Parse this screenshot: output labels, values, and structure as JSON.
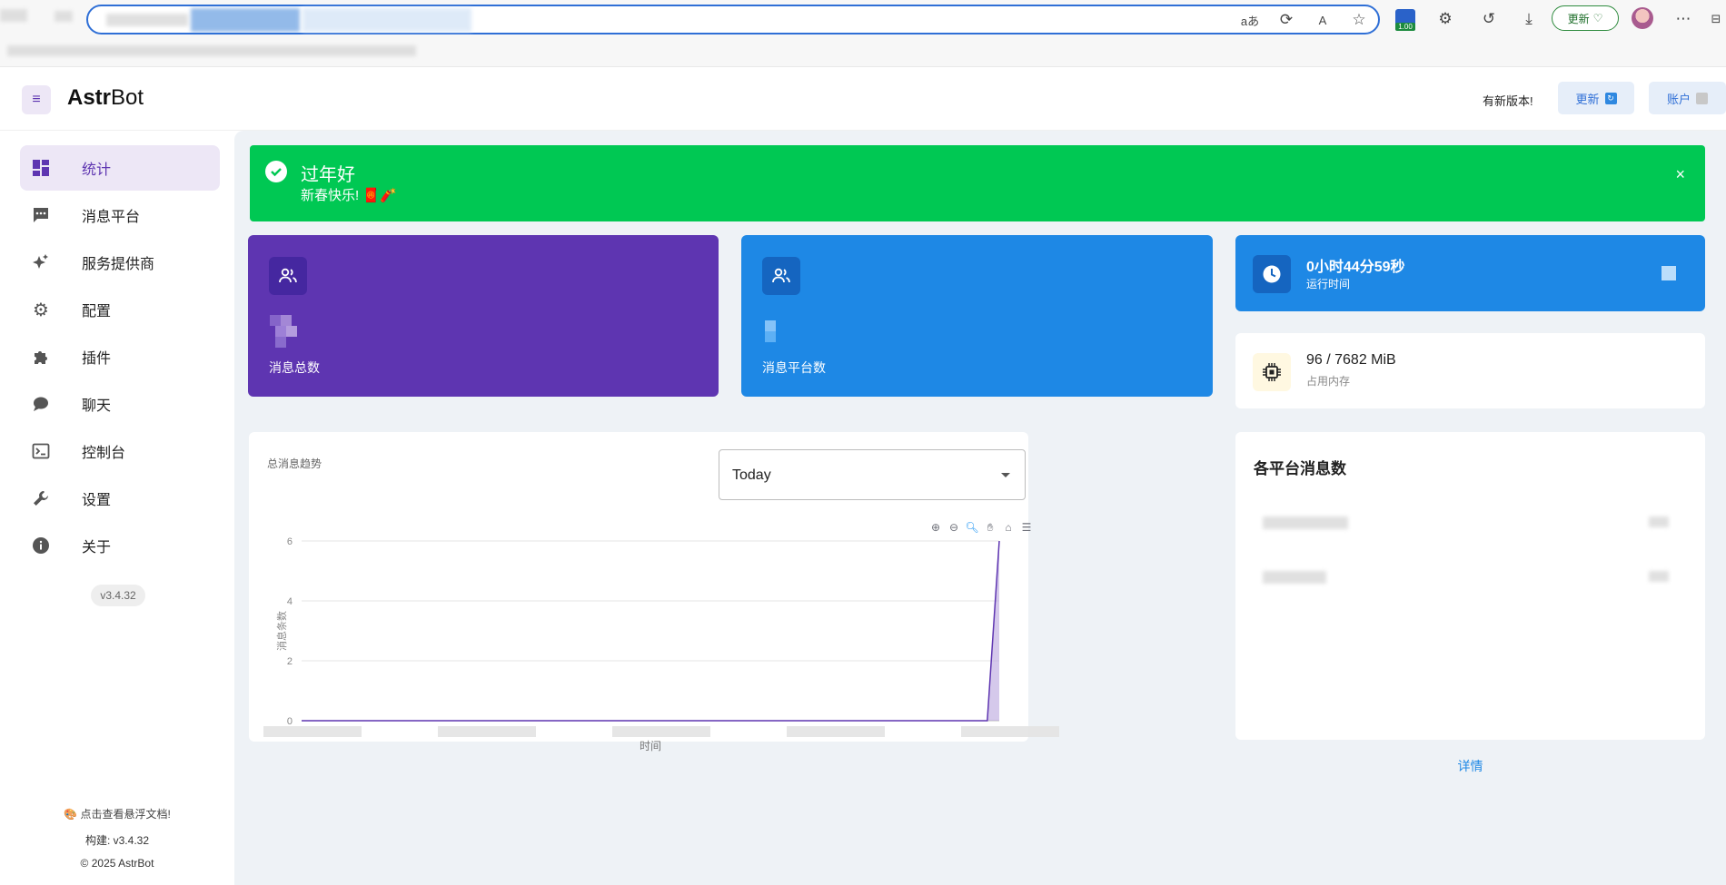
{
  "browser": {
    "update_label": "更新",
    "badge_value": "1.00"
  },
  "header": {
    "brand_bold": "Astr",
    "brand_rest": "Bot",
    "new_version_text": "有新版本!",
    "update_button": "更新",
    "account_button": "账户"
  },
  "sidebar": {
    "items": [
      {
        "label": "统计",
        "icon": "dashboard-icon",
        "active": true
      },
      {
        "label": "消息平台",
        "icon": "message-icon"
      },
      {
        "label": "服务提供商",
        "icon": "sparkle-icon"
      },
      {
        "label": "配置",
        "icon": "gear-icon"
      },
      {
        "label": "插件",
        "icon": "puzzle-icon"
      },
      {
        "label": "聊天",
        "icon": "chat-bubble-icon"
      },
      {
        "label": "控制台",
        "icon": "terminal-icon"
      },
      {
        "label": "设置",
        "icon": "wrench-icon"
      },
      {
        "label": "关于",
        "icon": "info-icon"
      }
    ],
    "version_chip": "v3.4.32",
    "docs_link": "🎨 点击查看悬浮文档!",
    "build": "构建: v3.4.32",
    "copyright": "© 2025 AstrBot"
  },
  "alert": {
    "title": "过年好",
    "subtitle": "新春快乐! 🧧🧨",
    "close": "×"
  },
  "stats": {
    "total_messages_label": "消息总数",
    "platform_count_label": "消息平台数",
    "uptime_value": "0小时44分59秒",
    "uptime_label": "运行时间",
    "memory_value": "96 / 7682 MiB",
    "memory_label": "占用内存"
  },
  "trend": {
    "title": "总消息趋势",
    "range_selected": "Today"
  },
  "platforms": {
    "title": "各平台消息数",
    "detail_link": "详情"
  },
  "colors": {
    "purple": "#5e35b1",
    "blue": "#1e88e5",
    "green": "#00c853",
    "accent": "#2f6fd6"
  },
  "chart_data": {
    "type": "area",
    "title": "总消息趋势",
    "xlabel": "时间",
    "ylabel": "消息条数",
    "ylim": [
      0,
      6
    ],
    "yticks": [
      0,
      2,
      4,
      6
    ],
    "grid": true,
    "series": [
      {
        "values": [
          0,
          0,
          0,
          0,
          0,
          0,
          0,
          0,
          0,
          0,
          0,
          0,
          0,
          0,
          0,
          0,
          0,
          0,
          0,
          0,
          0,
          0,
          0,
          0,
          0,
          0,
          0,
          0,
          0,
          0,
          0,
          0,
          0,
          0,
          0,
          0,
          0,
          0,
          0,
          0,
          0,
          0,
          0,
          0,
          0,
          0,
          0,
          0,
          0,
          0,
          0,
          0,
          0,
          0,
          0,
          0,
          0,
          0,
          6
        ]
      }
    ]
  }
}
